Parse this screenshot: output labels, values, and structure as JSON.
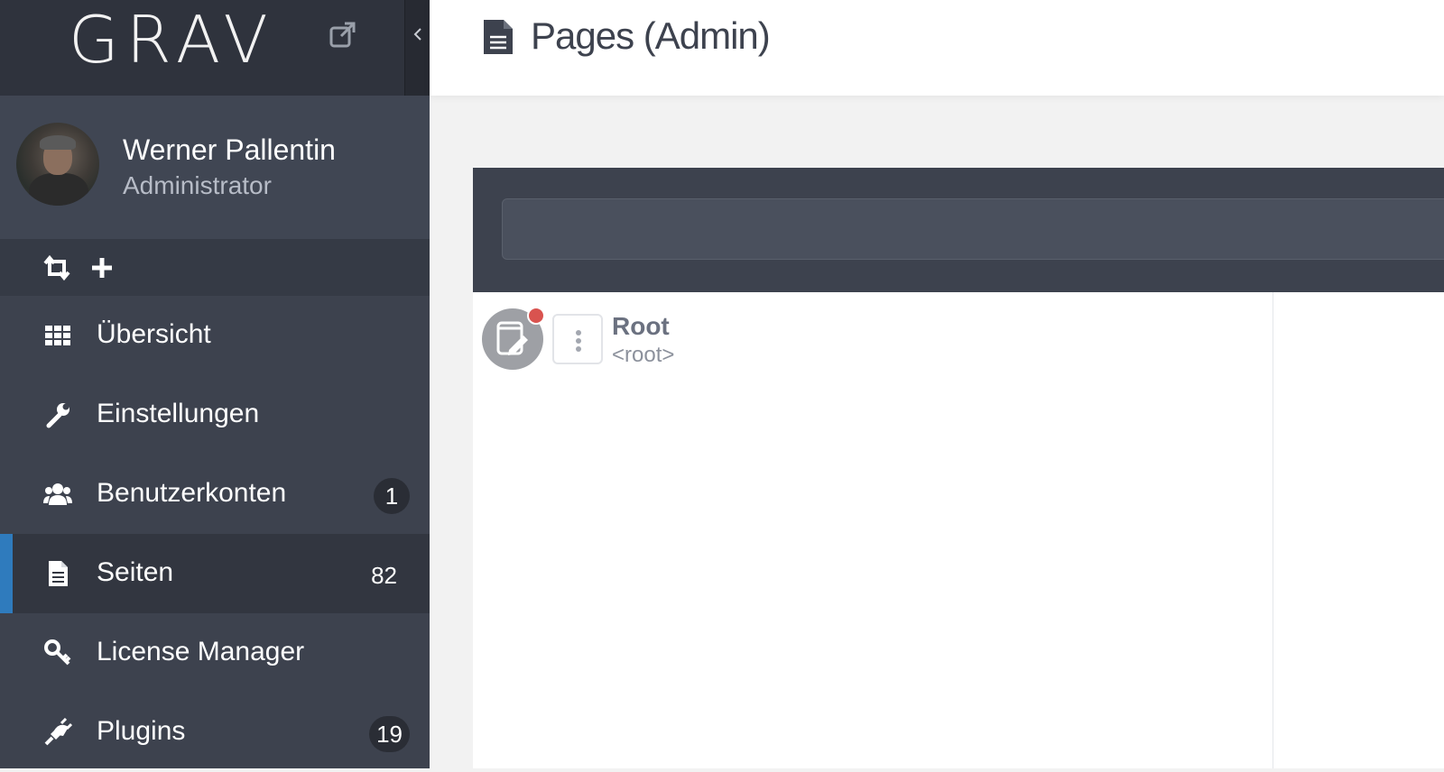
{
  "brand": {
    "logo_text": "GRAV"
  },
  "user": {
    "name": "Werner Pallentin",
    "role": "Administrator"
  },
  "nav": {
    "items": [
      {
        "label": "Übersicht",
        "badge": "",
        "icon": "dashboard-grid-icon"
      },
      {
        "label": "Einstellungen",
        "badge": "",
        "icon": "wrench-icon"
      },
      {
        "label": "Benutzerkonten",
        "badge": "1",
        "icon": "users-icon"
      },
      {
        "label": "Seiten",
        "badge": "82",
        "icon": "file-icon",
        "active": true
      },
      {
        "label": "License Manager",
        "badge": "",
        "icon": "key-icon"
      },
      {
        "label": "Plugins",
        "badge": "19",
        "icon": "plug-icon"
      }
    ]
  },
  "header": {
    "title": "Pages (Admin)"
  },
  "filter": {
    "value": "",
    "placeholder": ""
  },
  "tree": {
    "root": {
      "title": "Root",
      "slug": "<root>"
    }
  },
  "colors": {
    "accent": "#2f7bbd",
    "sidebar": "#3d424e",
    "alert_dot": "#d9534f"
  }
}
